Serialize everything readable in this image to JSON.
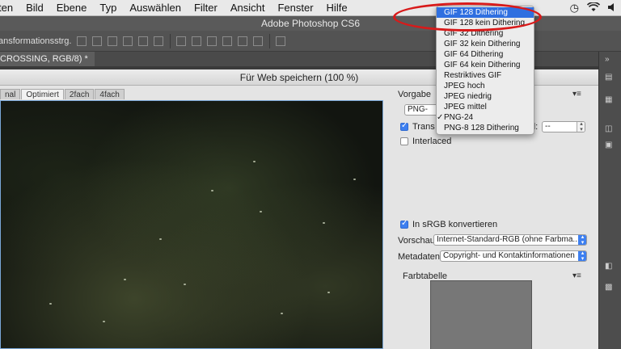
{
  "menubar": {
    "items": [
      "ten",
      "Bild",
      "Ebene",
      "Typ",
      "Auswählen",
      "Filter",
      "Ansicht",
      "Fenster",
      "Hilfe"
    ],
    "status_icons": [
      "clock-icon",
      "wifi-icon",
      "volume-icon"
    ]
  },
  "app": {
    "title": "Adobe Photoshop CS6"
  },
  "options_bar": {
    "label": "ansformationsstrg."
  },
  "document": {
    "tab_label": "CROSSING, RGB/8) *"
  },
  "dialog": {
    "title": "Für Web speichern (100 %)",
    "view_tabs": [
      "nal",
      "Optimiert",
      "2fach",
      "4fach"
    ],
    "active_view_tab": "Optimiert"
  },
  "settings": {
    "preset_label": "Vorgabe",
    "format_value": "PNG-",
    "transparency_label": "Trans",
    "transparency_checked": true,
    "matte_label": "d:",
    "matte_value": "--",
    "interlaced_label": "Interlaced",
    "interlaced_checked": false,
    "srgb_label": "In sRGB konvertieren",
    "srgb_checked": true,
    "preview_label": "Vorschau:",
    "preview_value": "Internet-Standard-RGB (ohne Farbma...",
    "metadata_label": "Metadaten:",
    "metadata_value": "Copyright- und Kontaktinformationen",
    "color_table_label": "Farbtabelle"
  },
  "format_dropdown": {
    "options": [
      "GIF 128 Dithering",
      "GIF 128 kein Dithering",
      "GIF 32 Dithering",
      "GIF 32 kein Dithering",
      "GIF 64 Dithering",
      "GIF 64 kein Dithering",
      "Restriktives GIF",
      "JPEG hoch",
      "JPEG niedrig",
      "JPEG mittel",
      "PNG-24",
      "PNG-8 128 Dithering"
    ],
    "highlighted": "GIF 128 Dithering",
    "checked": "PNG-24"
  },
  "annotation": {
    "color": "#d81a1a"
  }
}
